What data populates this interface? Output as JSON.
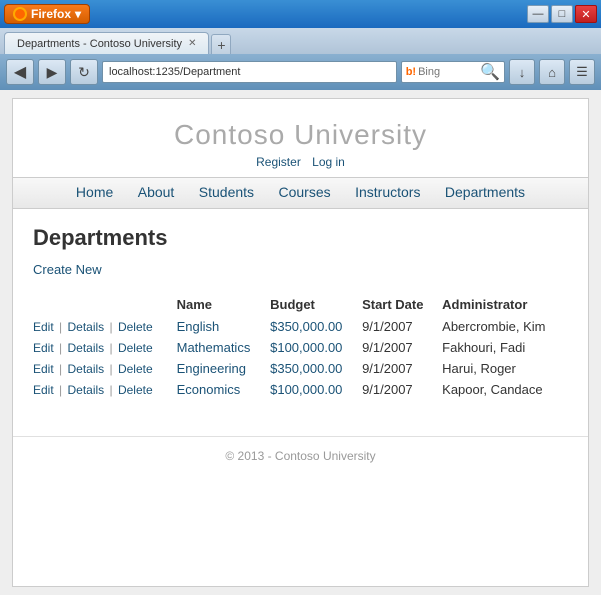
{
  "browser": {
    "tab_title": "Departments - Contoso University",
    "address": "localhost:1235/Department",
    "search_placeholder": "Bing",
    "firefox_label": "Firefox",
    "new_tab_symbol": "+",
    "back_symbol": "◀",
    "forward_symbol": "▶",
    "refresh_symbol": "↻",
    "home_symbol": "⌂",
    "download_symbol": "↓",
    "settings_symbol": "☰",
    "search_icon": "🔍"
  },
  "window_controls": {
    "minimize": "—",
    "maximize": "□",
    "close": "✕"
  },
  "site": {
    "title": "Contoso University",
    "auth_links": {
      "register": "Register",
      "login": "Log in"
    },
    "nav": {
      "home": "Home",
      "about": "About",
      "students": "Students",
      "courses": "Courses",
      "instructors": "Instructors",
      "departments": "Departments"
    }
  },
  "page": {
    "heading": "Departments",
    "create_new": "Create New",
    "table": {
      "headers": [
        "",
        "Name",
        "Budget",
        "Start Date",
        "Administrator"
      ],
      "rows": [
        {
          "actions": [
            "Edit",
            "Details",
            "Delete"
          ],
          "name": "English",
          "budget": "$350,000.00",
          "start_date": "9/1/2007",
          "administrator": "Abercrombie, Kim"
        },
        {
          "actions": [
            "Edit",
            "Details",
            "Delete"
          ],
          "name": "Mathematics",
          "budget": "$100,000.00",
          "start_date": "9/1/2007",
          "administrator": "Fakhouri, Fadi"
        },
        {
          "actions": [
            "Edit",
            "Details",
            "Delete"
          ],
          "name": "Engineering",
          "budget": "$350,000.00",
          "start_date": "9/1/2007",
          "administrator": "Harui, Roger"
        },
        {
          "actions": [
            "Edit",
            "Details",
            "Delete"
          ],
          "name": "Economics",
          "budget": "$100,000.00",
          "start_date": "9/1/2007",
          "administrator": "Kapoor, Candace"
        }
      ]
    }
  },
  "footer": {
    "text": "© 2013 - Contoso University"
  }
}
